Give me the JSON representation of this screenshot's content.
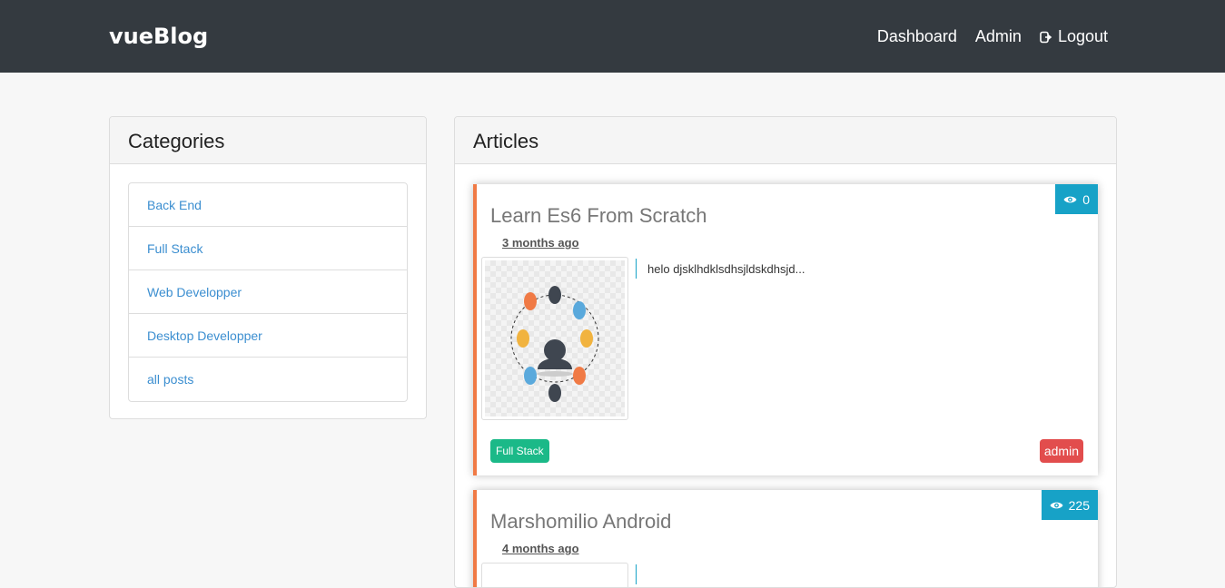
{
  "navbar": {
    "brand": "vueBlog",
    "links": {
      "dashboard": "Dashboard",
      "admin": "Admin",
      "logout": "Logout"
    }
  },
  "categories": {
    "title": "Categories",
    "items": [
      "Back End",
      "Full Stack",
      "Web Developper",
      "Desktop Developper",
      "all posts"
    ]
  },
  "articles": {
    "title": "Articles",
    "items": [
      {
        "title": "Learn Es6 From Scratch",
        "date": "3 months ago",
        "views": "0",
        "excerpt": "helo djsklhdklsdhsjldskdhsjd...",
        "category": "Full Stack",
        "author": "admin"
      },
      {
        "title": "Marshomilio Android",
        "date": "4 months ago",
        "views": "225"
      }
    ]
  },
  "icons": {
    "eye": "eye-icon",
    "logout": "sign-out-icon"
  },
  "colors": {
    "navbar": "#343a40",
    "accent": "#f07a45",
    "link": "#3b8ed0",
    "views_badge": "#17a2c7",
    "category_badge": "#1bb988",
    "author_badge": "#e24d4d"
  }
}
